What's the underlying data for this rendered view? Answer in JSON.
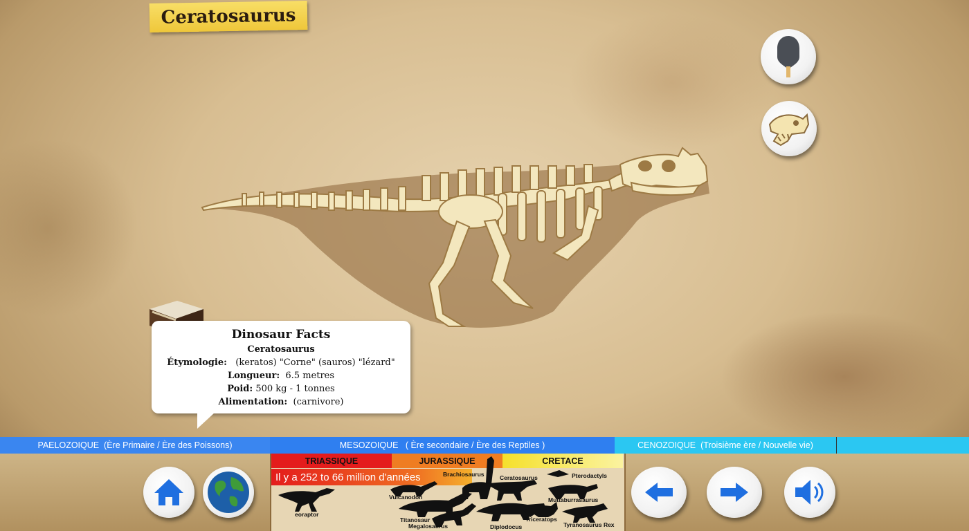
{
  "title": "Ceratosaurus",
  "facts": {
    "heading": "Dinosaur Facts",
    "name": "Ceratosaurus",
    "etymology_label": "Étymologie:",
    "etymology_value": "(keratos) \"Corne\" (sauros) \"lézard\"",
    "length_label": "Longueur:",
    "length_value": "6.5 metres",
    "weight_label": "Poid:",
    "weight_value": "500 kg - 1 tonnes",
    "diet_label": "Alimentation:",
    "diet_value": "(carnivore)"
  },
  "eras": {
    "paleozoic": "PAELOZOIQUE  (Ère Primaire / Ère des Poissons)",
    "mesozoic": "MESOZOIQUE   ( Ère secondaire / Ère des Reptiles )",
    "cenozoic": "CENOZOIQUE  (Troisième ère / Nouvelle vie)"
  },
  "periods": {
    "triassic": "TRIASSIQUE",
    "jurassic": "JURASSIQUE",
    "cretaceous": "CRETACE"
  },
  "timeline": {
    "range": "Il y a 252 to 66 million d'années",
    "dinosaurs": {
      "eoraptor": "eoraptor",
      "brachiosaurus": "Brachiosaurus",
      "ceratosaurus": "Ceratosaurus",
      "pterodactyls": "Pterodactyls",
      "vulcanodon": "Vulcanodon",
      "muttaburrasaurus": "Muttaburrasaurus",
      "titanosaur": "Titanosaur",
      "megalosaurus": "Megalosaurus",
      "diplodocus": "Diplodocus",
      "triceratops": "Triceratops",
      "tyranosaurus": "Tyranosaurus Rex"
    }
  },
  "icons": {
    "dig": "shovel-icon",
    "skull": "dino-skull-icon",
    "book": "book-icon",
    "home": "home-icon",
    "globe": "globe-icon",
    "prev": "arrow-left-icon",
    "next": "arrow-right-icon",
    "sound": "speaker-icon"
  },
  "colors": {
    "banner": "#efc73a",
    "era_blue": "#2f7ff0",
    "era_cyan": "#2bc7f2",
    "triassic": "#e41c1c",
    "jurassic": "#ef7d22",
    "cretaceous": "#f5e02c",
    "button_blue": "#1f6fe0"
  }
}
